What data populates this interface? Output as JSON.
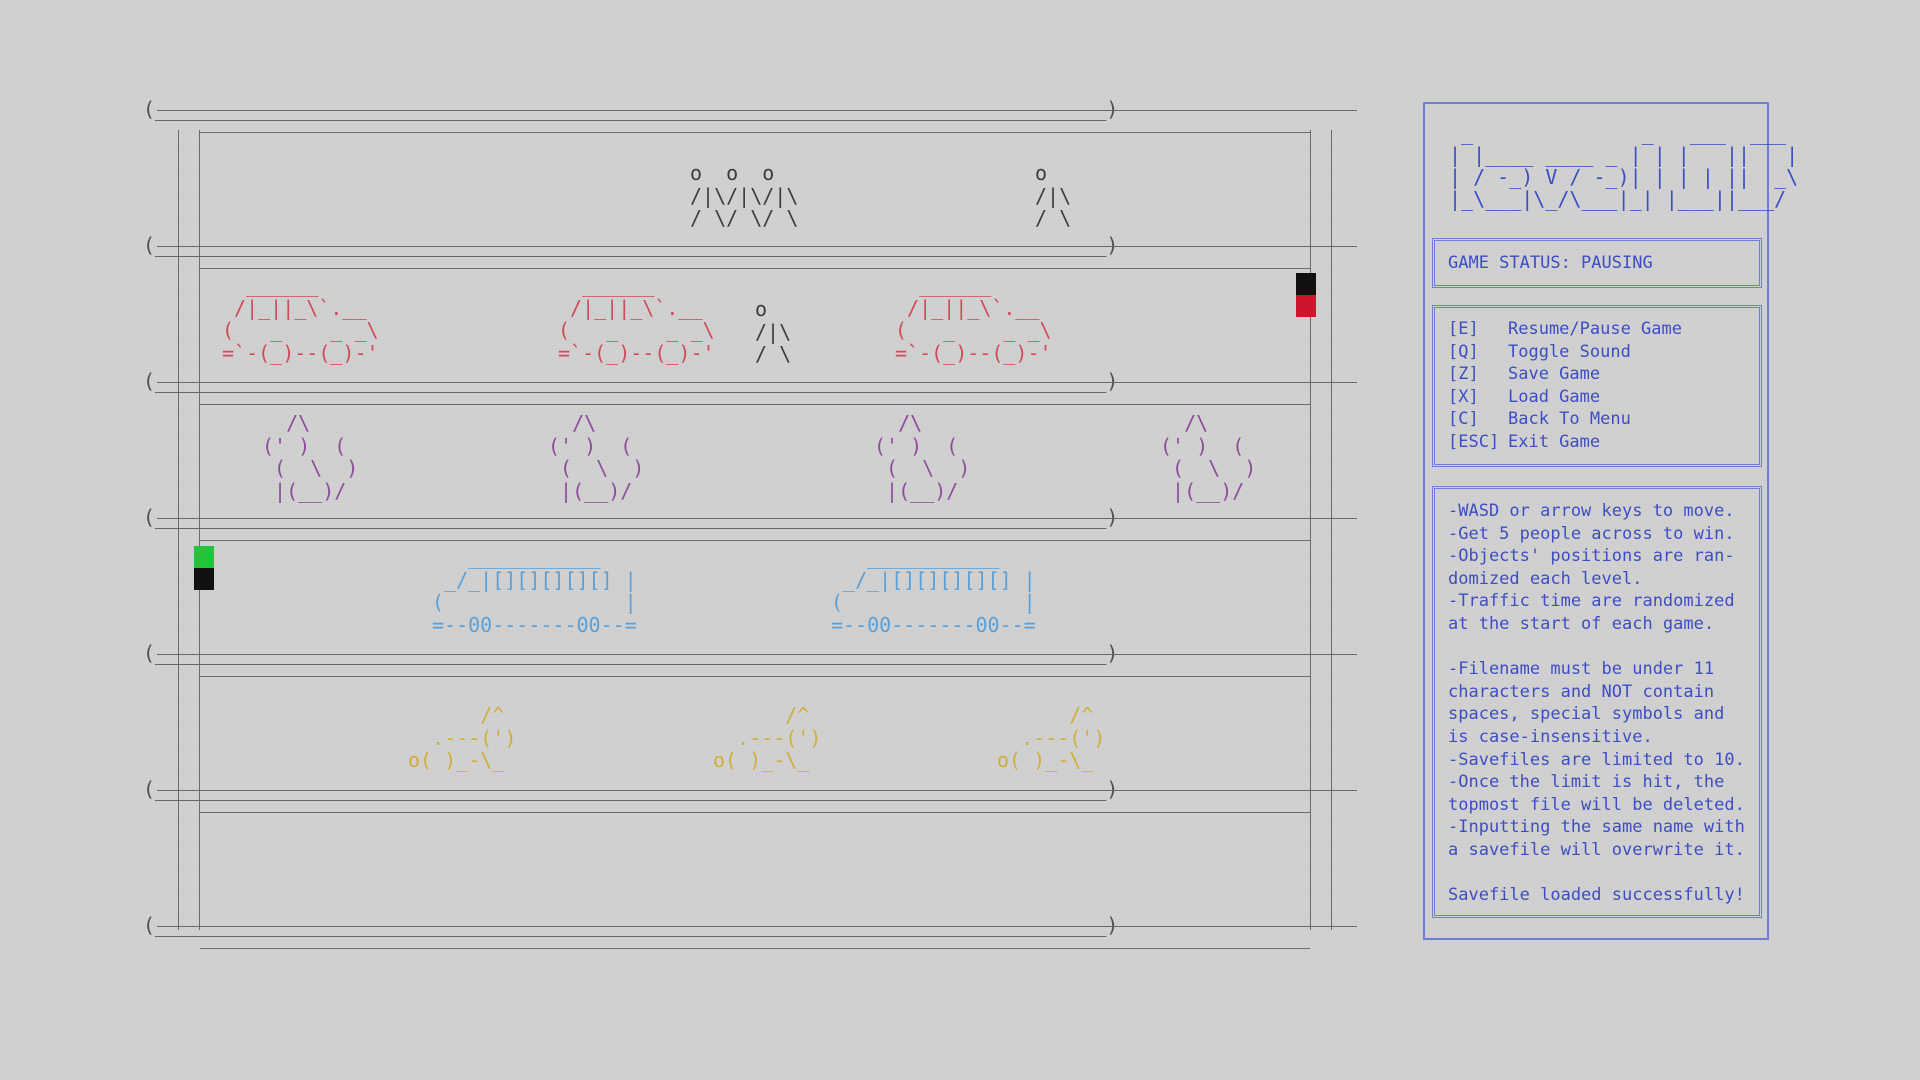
{
  "board": {
    "frame": {
      "edge_top": "(_______________________________________________________________________________)",
      "rail_left": "| |",
      "rail_right": "| |",
      "edge_mid": "(_______________________________________________________________________________)"
    },
    "lanes": [
      {
        "name": "top-sidewalk",
        "sprites": [
          {
            "kind": "people",
            "art": "o  o  o\n/|\\/|\\/|\\\n/ \\/ \\/ \\"
          },
          {
            "kind": "people",
            "art": "o\n/|\\\n/ \\"
          }
        ]
      },
      {
        "name": "car-lane",
        "sprites": [
          {
            "kind": "car",
            "art": "  ______\n /|_||_\\`.__\n(   _    _ _\\\n=`-(_)--(_)-'"
          },
          {
            "kind": "car",
            "art": "  ______\n /|_||_\\`.__\n(   _    _ _\\\n=`-(_)--(_)-'"
          },
          {
            "kind": "people",
            "art": "o\n/|\\\n/ \\"
          },
          {
            "kind": "car",
            "art": "  ______\n /|_||_\\`.__\n(   _    _ _\\\n=`-(_)--(_)-'"
          }
        ],
        "marker": {
          "top_color": "#111111",
          "bottom_color": "#d0142c"
        }
      },
      {
        "name": "chicken-lane",
        "sprites": [
          {
            "kind": "chicken",
            "art": "  /\\\n(' )  (\n (  \\  )\n |(__)/"
          },
          {
            "kind": "chicken",
            "art": "  /\\\n(' )  (\n (  \\  )\n |(__)/"
          },
          {
            "kind": "chicken",
            "art": "  /\\\n(' )  (\n (  \\  )\n |(__)/"
          },
          {
            "kind": "chicken",
            "art": "  /\\\n(' )  (\n (  \\  )\n |(__)/"
          }
        ]
      },
      {
        "name": "bus-lane",
        "sprites": [
          {
            "kind": "bus",
            "art": "   ___________\n _/_|[][][][][] |\n(               |\n=--00-------00--="
          },
          {
            "kind": "bus",
            "art": "   ___________\n _/_|[][][][][] |\n(               |\n=--00-------00--="
          }
        ],
        "marker": {
          "top_color": "#22c43a",
          "bottom_color": "#111111"
        }
      },
      {
        "name": "dog-lane",
        "sprites": [
          {
            "kind": "dog",
            "art": "      /^\n  .---(')\no( )_-\\_"
          },
          {
            "kind": "dog",
            "art": "      /^\n  .---(')\no( )_-\\_"
          },
          {
            "kind": "dog",
            "art": "      /^\n  .---(')\no( )_-\\_"
          }
        ]
      },
      {
        "name": "bottom-sidewalk",
        "sprites": []
      }
    ]
  },
  "panel": {
    "logo": " _              _   ___  ___\n| |____ ____ _ | | |   ||   |\n| / -_) V / -_)| | | | ||  _\\\n|_\\___|\\_/\\___|_| |___||___/",
    "status": "GAME STATUS: PAUSING",
    "keys": [
      {
        "key": "[E]",
        "action": "Resume/Pause Game"
      },
      {
        "key": "[Q]",
        "action": "Toggle Sound"
      },
      {
        "key": "[Z]",
        "action": "Save Game"
      },
      {
        "key": "[X]",
        "action": "Load Game"
      },
      {
        "key": "[C]",
        "action": "Back To Menu"
      },
      {
        "key": "[ESC]",
        "action": "Exit Game"
      }
    ],
    "help": "-WASD or arrow keys to move.\n-Get 5 people across to win.\n-Objects' positions are ran-\ndomized each level.\n-Traffic time are randomized\nat the start of each game.\n\n-Filename must be under 11\ncharacters and NOT contain\nspaces, special symbols and\nis case-insensitive.\n-Savefiles are limited to 10.\n-Once the limit is hit, the\ntopmost file will be deleted.\n-Inputting the same name with\na savefile will overwrite it.\n\nSavefile loaded successfully!"
  }
}
